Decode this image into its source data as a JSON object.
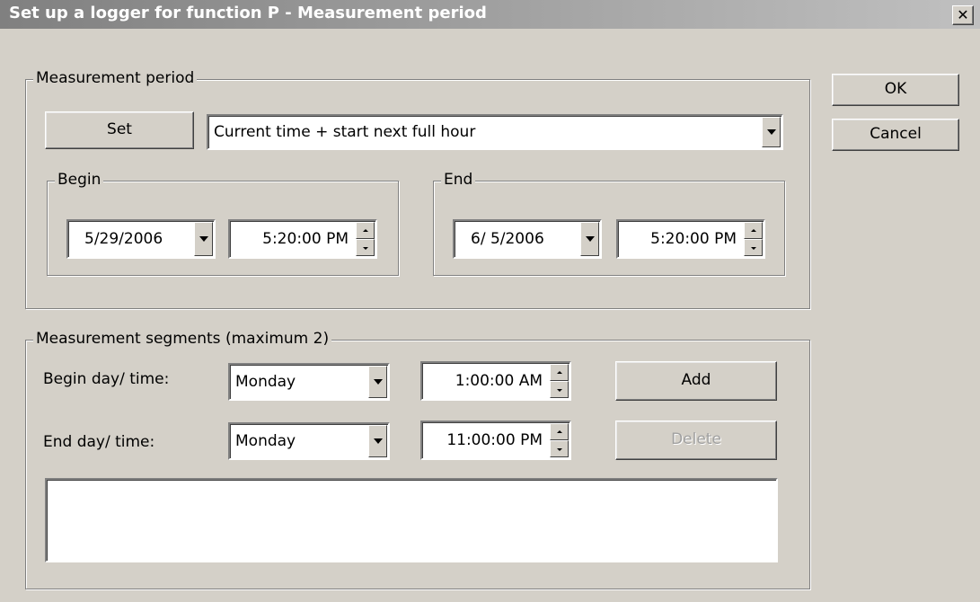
{
  "window": {
    "title": "Set up a logger for function P - Measurement period",
    "close_glyph": "✕"
  },
  "buttons": {
    "ok": "OK",
    "cancel": "Cancel",
    "set": "Set",
    "add": "Add",
    "delete": "Delete"
  },
  "period": {
    "legend": "Measurement period",
    "preset": "Current time + start next full hour",
    "begin": {
      "legend": "Begin",
      "date": "5/29/2006",
      "time": "5:20:00 PM"
    },
    "end": {
      "legend": "End",
      "date": "6/ 5/2006",
      "time": "5:20:00 PM"
    }
  },
  "segments": {
    "legend": "Measurement segments (maximum 2)",
    "begin_label": "Begin day/ time:",
    "begin_day": "Monday",
    "begin_time": "1:00:00 AM",
    "end_label": "End day/ time:",
    "end_day": "Monday",
    "end_time": "11:00:00 PM",
    "list_items": []
  },
  "icons": {
    "dropdown": "chevron-down-icon",
    "spin_up": "arrow-up-icon",
    "spin_down": "arrow-down-icon"
  }
}
